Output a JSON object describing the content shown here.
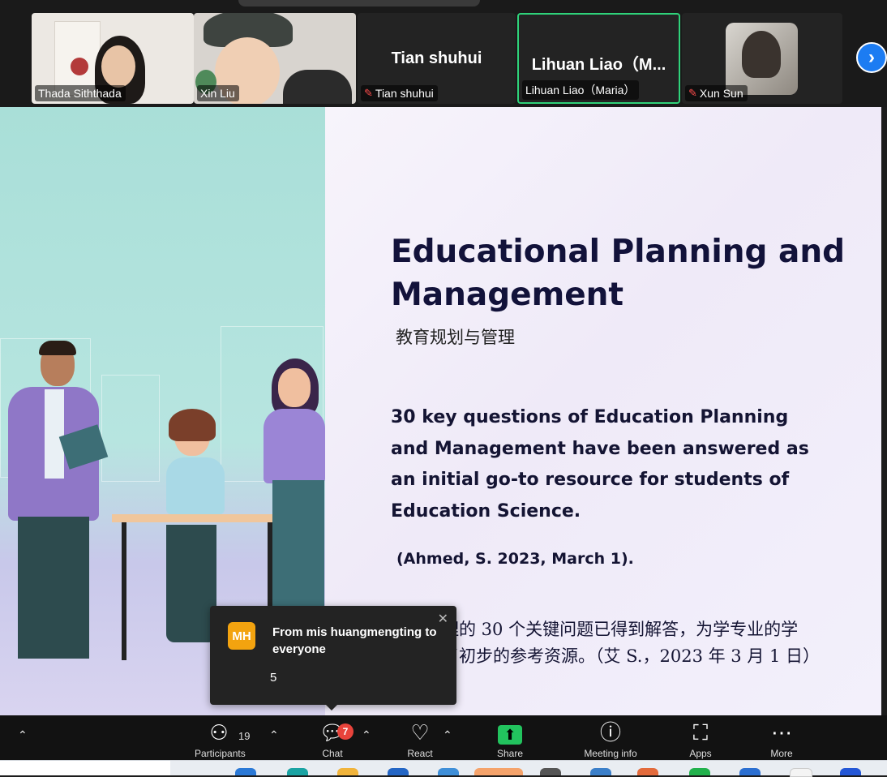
{
  "participants": [
    {
      "name": "Thada Siththada",
      "muted": false,
      "video": true
    },
    {
      "name": "Xin Liu",
      "muted": false,
      "video": true
    },
    {
      "name": "Tian shuhui",
      "muted": true,
      "video": false,
      "display": "Tian shuhui"
    },
    {
      "name": "Lihuan Liao（Maria）",
      "muted": false,
      "video": false,
      "display": "Lihuan  Liao（M...",
      "speaking": true
    },
    {
      "name": "Xun Sun",
      "muted": true,
      "video": true
    }
  ],
  "slide": {
    "title": "Educational Planning and Management",
    "subtitle": "教育规划与管理",
    "body": "30 key questions of Education Planning and Management have been answered as an initial go-to resource for students of Education Science.",
    "citation": "(Ahmed, S. 2023, March 1).",
    "chinese_body": "划与管理的 30 个关键问题已得到解答，为学专业的学生提供了初步的参考资源。（艾 S.，2023 年 3 月 1 日）"
  },
  "chat_toast": {
    "avatar_initials": "MH",
    "from": "From mis huangmengting to everyone",
    "message": "5",
    "avatar_color": "#f3a30f"
  },
  "toolbar": {
    "participants_count": "19",
    "participants_label": "Participants",
    "chat_label": "Chat",
    "chat_badge": "7",
    "react_label": "React",
    "share_label": "Share",
    "info_label": "Meeting info",
    "apps_label": "Apps",
    "more_label": "More"
  },
  "icons": {
    "participants": "people-icon",
    "chat": "chat-bubble-icon",
    "react": "heart-icon",
    "share": "share-screen-icon",
    "info": "info-icon",
    "apps": "apps-icon",
    "more": "more-icon",
    "next": "chevron-right-icon"
  },
  "colors": {
    "speaking_border": "#2fd27a",
    "share_green": "#22c35e",
    "badge_red": "#e8433b",
    "next_blue": "#1c7cf2"
  }
}
